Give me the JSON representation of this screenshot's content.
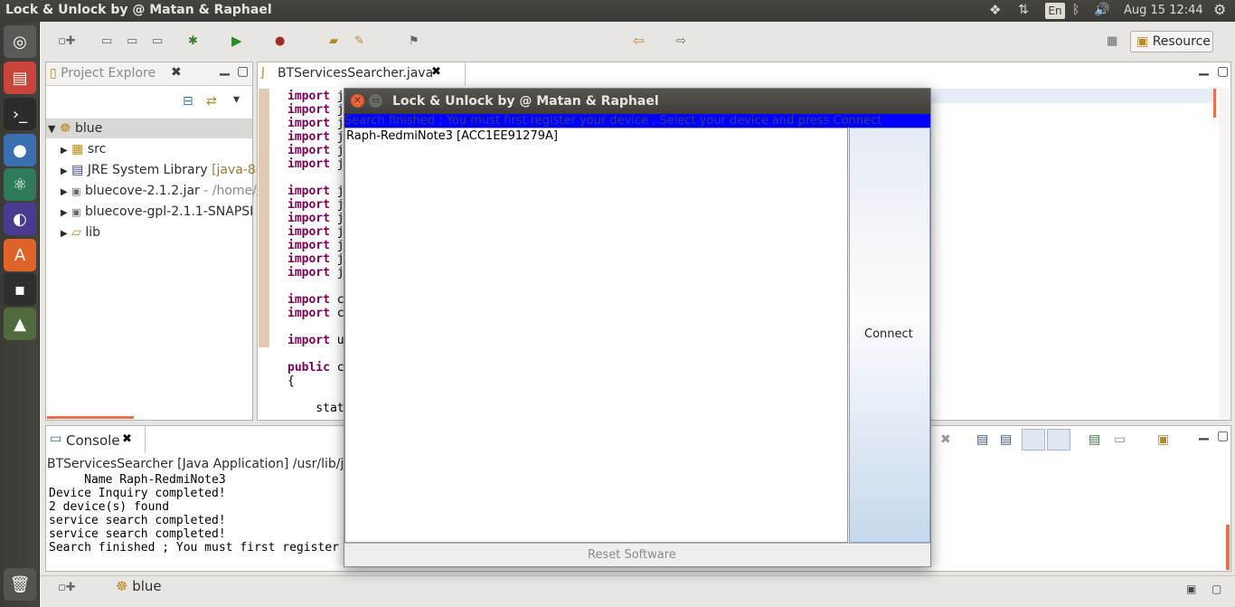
{
  "topbar": {
    "title": "Lock & Unlock by @ Matan & Raphael",
    "lang": "En",
    "datetime": "Aug 15 12:44"
  },
  "toolbar": {
    "perspective_label": "Resource"
  },
  "project_explorer": {
    "tab_label": "Project Explore",
    "root": "blue",
    "items": [
      {
        "label": "src",
        "icon": "package-folder-icon"
      },
      {
        "label": "JRE System Library",
        "suffix": "[java-8-",
        "icon": "library-icon"
      },
      {
        "label": "bluecove-2.1.2.jar",
        "suffix": "- /home/",
        "icon": "jar-icon"
      },
      {
        "label": "bluecove-gpl-2.1.1-SNAPSH",
        "suffix": "",
        "icon": "jar-icon"
      },
      {
        "label": "lib",
        "icon": "folder-icon"
      }
    ]
  },
  "editor": {
    "tab_label": "BTServicesSearcher.java",
    "lines": [
      {
        "kw": "import",
        "rest": " j"
      },
      {
        "kw": "import",
        "rest": " j"
      },
      {
        "kw": "import",
        "rest": " j"
      },
      {
        "kw": "import",
        "rest": " j"
      },
      {
        "kw": "import",
        "rest": " j"
      },
      {
        "kw": "import",
        "rest": " j"
      },
      {
        "kw": "",
        "rest": ""
      },
      {
        "kw": "import",
        "rest": " j"
      },
      {
        "kw": "import",
        "rest": " j"
      },
      {
        "kw": "import",
        "rest": " j"
      },
      {
        "kw": "import",
        "rest": " j"
      },
      {
        "kw": "import",
        "rest": " j"
      },
      {
        "kw": "import",
        "rest": " j"
      },
      {
        "kw": "import",
        "rest": " j"
      },
      {
        "kw": "",
        "rest": ""
      },
      {
        "kw": "import",
        "rest": " c"
      },
      {
        "kw": "import",
        "rest": " c"
      },
      {
        "kw": "",
        "rest": ""
      },
      {
        "kw": "import",
        "rest": " u"
      },
      {
        "kw": "",
        "rest": ""
      },
      {
        "kw": "public",
        "rest": " c"
      },
      {
        "kw": "",
        "rest": "{"
      },
      {
        "kw": "",
        "rest": ""
      },
      {
        "kw": "",
        "rest": "    stat"
      }
    ]
  },
  "console": {
    "tab_label": "Console",
    "header": "BTServicesSearcher [Java Application] /usr/lib/jv",
    "lines": [
      "     Name Raph-RedmiNote3",
      "Device Inquiry completed!",
      "2 device(s) found",
      "service search completed!",
      "service search completed!",
      "Search finished ; You must first register"
    ]
  },
  "statusbar": {
    "project": "blue"
  },
  "dialog": {
    "title": "Lock & Unlock by @ Matan & Raphael",
    "status_message": "Search finished ; You must first register your device , Select your device and press Connect",
    "devices": [
      "Raph-RedmiNote3 [ACC1EE91279A]"
    ],
    "connect_label": "Connect",
    "reset_label": "Reset Software"
  }
}
